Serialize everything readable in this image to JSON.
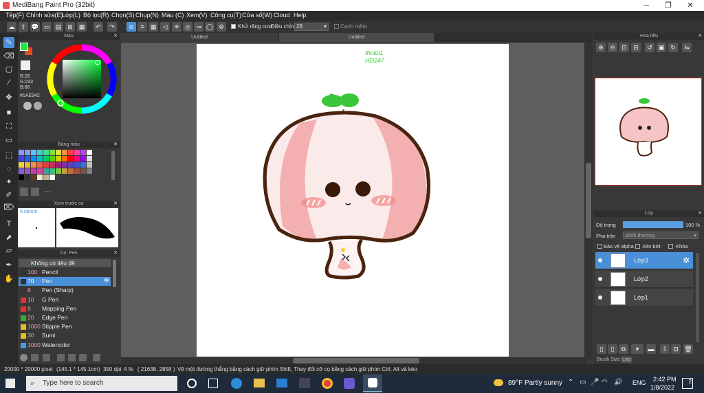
{
  "titlebar": {
    "title": "MediBang Paint Pro (32bit)",
    "minimize": "─",
    "restore": "❐",
    "close": "✕"
  },
  "menu": [
    "Tệp(F)",
    "Chỉnh sửa(E)",
    "Lớp(L)",
    "Bộ lọc(R)",
    "Chọn(S)",
    "Chụp(N)",
    "Màu (C)",
    "Xem(V)",
    "Công cụ(T)",
    "Cửa sổ(W)",
    "Cloud",
    "Help"
  ],
  "toolbar": {
    "antialias_label": "Khử răng cưa",
    "correction_label": "Điều chỉnh",
    "correction_value": "28",
    "soft_edge_label": "Cạnh mềm"
  },
  "tabs": {
    "left": "Untitled",
    "right": "Untitled"
  },
  "color_panel": {
    "title": "Màu",
    "r": "R:26",
    "g": "G:233",
    "b": "B:66",
    "hex": "#1AE942",
    "fg": "#1AE942",
    "bg": "#e05020"
  },
  "palette_panel": {
    "title": "Bảng màu",
    "more": "···"
  },
  "preview_panel": {
    "title": "Xem trước cọ",
    "size": "5.08mm"
  },
  "brush_panel": {
    "title": "Cọ: Pen",
    "group": "Không có tiêu đề",
    "items": [
      {
        "size": "100",
        "name": "Pencil",
        "color": "#333333"
      },
      {
        "size": "70",
        "name": "Pen",
        "color": "#333333"
      },
      {
        "size": "8",
        "name": "Pen (Sharp)",
        "color": "#333333"
      },
      {
        "size": "10",
        "name": "G Pen",
        "color": "#e03030"
      },
      {
        "size": "8",
        "name": "Mapping Pen",
        "color": "#e03030"
      },
      {
        "size": "20",
        "name": "Edge Pen",
        "color": "#30b030"
      },
      {
        "size": "1000",
        "name": "Stipple Pen",
        "color": "#e0c020"
      },
      {
        "size": "30",
        "name": "Sumi",
        "color": "#e0c020"
      },
      {
        "size": "1000",
        "name": "Watercolor",
        "color": "#40a0e0"
      }
    ]
  },
  "navigator": {
    "title": "Hoa tiêu"
  },
  "layers": {
    "title": "Lớp",
    "opacity_label": "Độ trong",
    "opacity_value": "100 %",
    "blend_label": "Pha trộn",
    "blend_value": "Bình thường",
    "protect_alpha": "Bảo vệ alpha",
    "clipping": "Xén bớt",
    "lock": "Khóa",
    "items": [
      {
        "name": "Lớp3"
      },
      {
        "name": "Lớp2"
      },
      {
        "name": "Lớp1"
      }
    ],
    "tab_brush_size": "Brush Size",
    "tab_layer": "Lớp"
  },
  "drawing": {
    "signature": "tholoi1\nHD247"
  },
  "statusbar": {
    "size": "20000 * 20000 pixel",
    "dims": "(145.1 * 145.1cm)",
    "dpi": "350 dpi",
    "zoom": "4 %",
    "coords": "( 21638, 2858 )",
    "hint": "Vẽ một đường thẳng bằng cách giữ phím Shift, Thay đổi cỡ cọ bằng cách giữ phím Ctrl, Alt và kéo"
  },
  "taskbar": {
    "search": "Type here to search",
    "weather": "89°F  Partly sunny",
    "lang": "ENG",
    "time": "2:42 PM",
    "date": "1/8/2022",
    "notif": "2"
  },
  "colors": {
    "accent": "#4a90d9",
    "peach": "#f4b8b8",
    "outline": "#4a2410",
    "leaf": "#3ac63a"
  }
}
